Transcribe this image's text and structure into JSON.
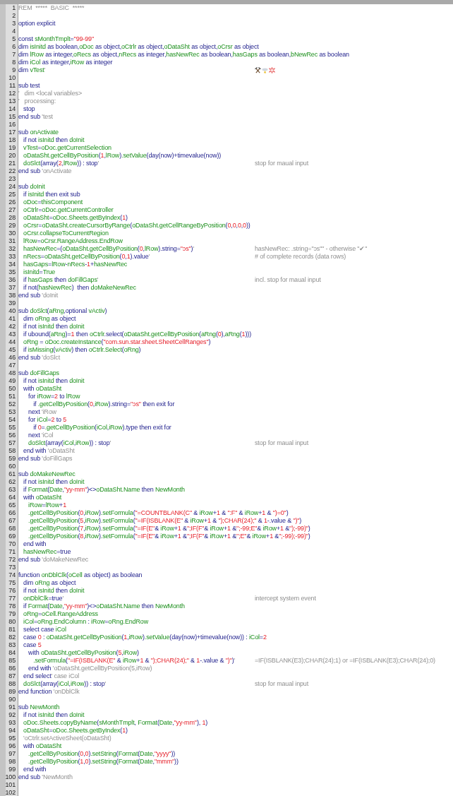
{
  "editor": {
    "lines": [
      {
        "number": "1",
        "kind": "remark",
        "code": "REM  *****  BASIC  *****"
      },
      {
        "number": "2"
      },
      {
        "number": "3",
        "kind": "code",
        "code": "option explicit"
      },
      {
        "number": "4"
      },
      {
        "number": "5",
        "kind": "code",
        "code": "const sMonthTmplt=\"99-99\""
      },
      {
        "number": "6",
        "kind": "code",
        "code": "dim isInitd as boolean,oDoc as object,oCtrlr as object,oDataSht as object,oCrsr as object"
      },
      {
        "number": "7",
        "kind": "code",
        "code": "dim lRow as integer,oRecs as object,nRecs as integer,hasNewRec as boolean,hasGaps as boolean,bNewRec as boolean"
      },
      {
        "number": "8",
        "kind": "code",
        "code": "dim iCol as integer,iRow as integer"
      },
      {
        "number": "9",
        "kind": "code",
        "code": "dim vTest'"
      },
      {
        "number": "10"
      },
      {
        "number": "11",
        "kind": "code",
        "code": "sub test"
      },
      {
        "number": "12",
        "kind": "code",
        "code": "'   dim <local variables>"
      },
      {
        "number": "13",
        "kind": "code",
        "code": "'   processing:"
      },
      {
        "number": "14",
        "kind": "code",
        "code": "   stop"
      },
      {
        "number": "15",
        "kind": "code",
        "code": "end sub 'test"
      },
      {
        "number": "16"
      },
      {
        "number": "17",
        "kind": "code",
        "code": "sub onActivate"
      },
      {
        "number": "18",
        "kind": "code",
        "code": "   if not isInitd then doInit"
      },
      {
        "number": "19",
        "kind": "code",
        "code": "   vTest=oDoc.getCurrentSelection"
      },
      {
        "number": "20",
        "kind": "code",
        "code": "   oDataSht.getCellByPosition(1,lRow).setValue(day(now)+timevalue(now))"
      },
      {
        "number": "21",
        "kind": "code",
        "code": "   doSlct(array(2,lRow)) : stop'",
        "comment": "stop for maual input"
      },
      {
        "number": "22",
        "kind": "code",
        "code": "end sub 'onActivate"
      },
      {
        "number": "23"
      },
      {
        "number": "24",
        "kind": "code",
        "code": "sub doInit"
      },
      {
        "number": "25",
        "kind": "code",
        "code": "   if isInitd then exit sub"
      },
      {
        "number": "26",
        "kind": "code",
        "code": "   oDoc=thisComponent"
      },
      {
        "number": "27",
        "kind": "code",
        "code": "   oCtrlr=oDoc.getCurrentController"
      },
      {
        "number": "28",
        "kind": "code",
        "code": "   oDataSht=oDoc.Sheets.getByIndex(1)"
      },
      {
        "number": "29",
        "kind": "code",
        "code": "   oCrsr=oDataSht.createCursorByRange(oDataSht.getCellRangeByPosition(0,0,0,0))"
      },
      {
        "number": "30",
        "kind": "code",
        "code": "   oCrsr.collapseToCurrentRegion"
      },
      {
        "number": "31",
        "kind": "code",
        "code": "   lRow=oCrsr.RangeAddress.EndRow"
      },
      {
        "number": "32",
        "kind": "code",
        "code": "   hasNewRec=(oDataSht.getCellByPosition(0,lRow).string=\"ↄs\")'",
        "comment": "hasNewRec: .string=\"ↄs\"\" - otherwise \"✔\""
      },
      {
        "number": "33",
        "kind": "code",
        "code": "   nRecs=oDataSht.getCellByPosition(0,1).value'",
        "comment": "# of complete records (data rows)"
      },
      {
        "number": "34",
        "kind": "code",
        "code": "   hasGaps=lRow-nRecs-1+hasNewRec"
      },
      {
        "number": "35",
        "kind": "code",
        "code": "   isInitd=True"
      },
      {
        "number": "36",
        "kind": "code",
        "code": "   if hasGaps then doFillGaps'",
        "comment": "incl. stop for maual input"
      },
      {
        "number": "37",
        "kind": "code",
        "code": "   if not(hasNewRec)  then doMakeNewRec"
      },
      {
        "number": "38",
        "kind": "code",
        "code": "end sub 'doInit"
      },
      {
        "number": "39"
      },
      {
        "number": "40",
        "kind": "code",
        "code": "sub doSlct(aRng,optional vActiv)"
      },
      {
        "number": "41",
        "kind": "code",
        "code": "   dim oRng as object"
      },
      {
        "number": "42",
        "kind": "code",
        "code": "   if not isInitd then doInit"
      },
      {
        "number": "43",
        "kind": "code",
        "code": "   if ubound(aRng)=1 then oCtrlr.select(oDataSht.getCellByPosition(aRng(0),aRng(1)))"
      },
      {
        "number": "44",
        "kind": "code",
        "code": "   oRng = oDoc.createInstance(\"com.sun.star.sheet.SheetCellRanges\")"
      },
      {
        "number": "45",
        "kind": "code",
        "code": "   if isMissing(vActiv) then oCtrlr.Select(oRng)"
      },
      {
        "number": "46",
        "kind": "code",
        "code": "end sub 'doSlct"
      },
      {
        "number": "47"
      },
      {
        "number": "48",
        "kind": "code",
        "code": "sub doFillGaps"
      },
      {
        "number": "49",
        "kind": "code",
        "code": "   if not isInitd then doInit"
      },
      {
        "number": "50",
        "kind": "code",
        "code": "   with oDataSht"
      },
      {
        "number": "51",
        "kind": "code",
        "code": "      for iRow=2 to lRow"
      },
      {
        "number": "52",
        "kind": "code",
        "code": "         if .getCellByPosition(0,iRow).string=\"ↄs\" then exit for"
      },
      {
        "number": "53",
        "kind": "code",
        "code": "      next 'iRow"
      },
      {
        "number": "54",
        "kind": "code",
        "code": "      for iCol=2 to 5"
      },
      {
        "number": "55",
        "kind": "code",
        "code": "         if 0=.getCellByPosition(iCol,iRow).type then exit for"
      },
      {
        "number": "56",
        "kind": "code",
        "code": "      next 'iCol"
      },
      {
        "number": "57",
        "kind": "code",
        "code": "      doSlct(array(iCol,iRow)) : stop'",
        "comment": "stop for maual input"
      },
      {
        "number": "58",
        "kind": "code",
        "code": "   end with 'oDataSht"
      },
      {
        "number": "59",
        "kind": "code",
        "code": "end sub 'doFillGaps"
      },
      {
        "number": "60"
      },
      {
        "number": "61",
        "kind": "code",
        "code": "sub doMakeNewRec"
      },
      {
        "number": "62",
        "kind": "code",
        "code": "   if not isInitd then doInit"
      },
      {
        "number": "63",
        "kind": "code",
        "code": "   if Format(Date,\"yy-mm\")<>oDataSht.Name then NewMonth"
      },
      {
        "number": "64",
        "kind": "code",
        "code": "   with oDataSht"
      },
      {
        "number": "65",
        "kind": "code",
        "code": "      iRow=lRow+1"
      },
      {
        "number": "66",
        "kind": "code",
        "code": "      .getCellByPosition(0,iRow).setFormula(\"=COUNTBLANK(C\" & iRow+1 & \":F\" & iRow+1 & \")=0\")"
      },
      {
        "number": "67",
        "kind": "code",
        "code": "      .getCellByPosition(5,iRow).setFormula(\"=IF(ISBLANK(E\" & iRow+1 & \");CHAR(24);\" & 1-.value & \")\")"
      },
      {
        "number": "68",
        "kind": "code",
        "code": "      .getCellByPosition(7,iRow).setFormula(\"=IF(E\"& iRow+1 &\";IF(F\"& iRow+1 &\";-99;E\"& iRow+1 &\");-99)\")"
      },
      {
        "number": "69",
        "kind": "code",
        "code": "      .getCellByPosition(8,iRow).setFormula(\"=IF(E\"& iRow+1 &\";IF(F\"& iRow+1 &\";E\"& iRow+1 &\";-99);-99)\")"
      },
      {
        "number": "70",
        "kind": "code",
        "code": "   end with"
      },
      {
        "number": "71",
        "kind": "code",
        "code": "   hasNewRec=true"
      },
      {
        "number": "72",
        "kind": "code",
        "code": "end sub 'doMakeNewRec"
      },
      {
        "number": "73"
      },
      {
        "number": "74",
        "kind": "code",
        "code": "function onDblClk(oCell as object) as boolean"
      },
      {
        "number": "75",
        "kind": "code",
        "code": "   dim oRng as object"
      },
      {
        "number": "76",
        "kind": "code",
        "code": "   if not isInitd then doInit"
      },
      {
        "number": "77",
        "kind": "code",
        "code": "   onDblClk=true'",
        "comment": "intercept system event"
      },
      {
        "number": "78",
        "kind": "code",
        "code": "   if Format(Date,\"yy-mm\")<>oDataSht.Name then NewMonth"
      },
      {
        "number": "79",
        "kind": "code",
        "code": "   oRng=oCell.RangeAddress"
      },
      {
        "number": "80",
        "kind": "code",
        "code": "   iCol=oRng.EndColumn : iRow=oRng.EndRow"
      },
      {
        "number": "81",
        "kind": "code",
        "code": "   select case iCol"
      },
      {
        "number": "82",
        "kind": "code",
        "code": "   case 0 : oDataSht.getCellByPosition(1,iRow).setValue(day(now)+timevalue(now)) : iCol=2"
      },
      {
        "number": "83",
        "kind": "code",
        "code": "   case 5"
      },
      {
        "number": "84",
        "kind": "code",
        "code": "      with oDataSht.getCellByPosition(5,iRow)"
      },
      {
        "number": "85",
        "kind": "code",
        "code": "         .setFormula(\"=IF(ISBLANK(E\" & iRow+1 & \");CHAR(24);\" & 1-.value & \")\")'",
        "comment": "=IF(ISBLANK(E3);CHAR(24);1) or =IF(ISBLANK(E3);CHAR(24);0)"
      },
      {
        "number": "86",
        "kind": "code",
        "code": "      end with 'oDataSht.getCellByPosition(5,iRow)"
      },
      {
        "number": "87",
        "kind": "code",
        "code": "   end select' case iCol"
      },
      {
        "number": "88",
        "kind": "code",
        "code": "   doSlct(array(iCol,iRow)) : stop'",
        "comment": "stop for maual input"
      },
      {
        "number": "89",
        "kind": "code",
        "code": "end function 'onDblClk"
      },
      {
        "number": "90"
      },
      {
        "number": "91",
        "kind": "code",
        "code": "sub NewMonth"
      },
      {
        "number": "92",
        "kind": "code",
        "code": "   if not isInitd then doInit"
      },
      {
        "number": "93",
        "kind": "code",
        "code": "   oDoc.Sheets.copyByName(sMonthTmplt, Format(Date,\"yy-mm\"), 1)"
      },
      {
        "number": "94",
        "kind": "code",
        "code": "   oDataSht=oDoc.Sheets.getByIndex(1)"
      },
      {
        "number": "95",
        "kind": "code",
        "code": "   'oCtrlr.setActiveSheet(oDataSht)"
      },
      {
        "number": "96",
        "kind": "code",
        "code": "   with oDataSht"
      },
      {
        "number": "97",
        "kind": "code",
        "code": "      .getCellByPosition(0,0).setString(Format(Date,\"yyyy\"))"
      },
      {
        "number": "98",
        "kind": "code",
        "code": "      .getCellByPosition(1,0).setString(Format(Date,\"mmm\"))"
      },
      {
        "number": "99",
        "kind": "code",
        "code": "   end with"
      },
      {
        "number": "100",
        "kind": "code",
        "code": "end sub 'NewMonth"
      },
      {
        "number": "101"
      },
      {
        "number": "102"
      }
    ]
  }
}
